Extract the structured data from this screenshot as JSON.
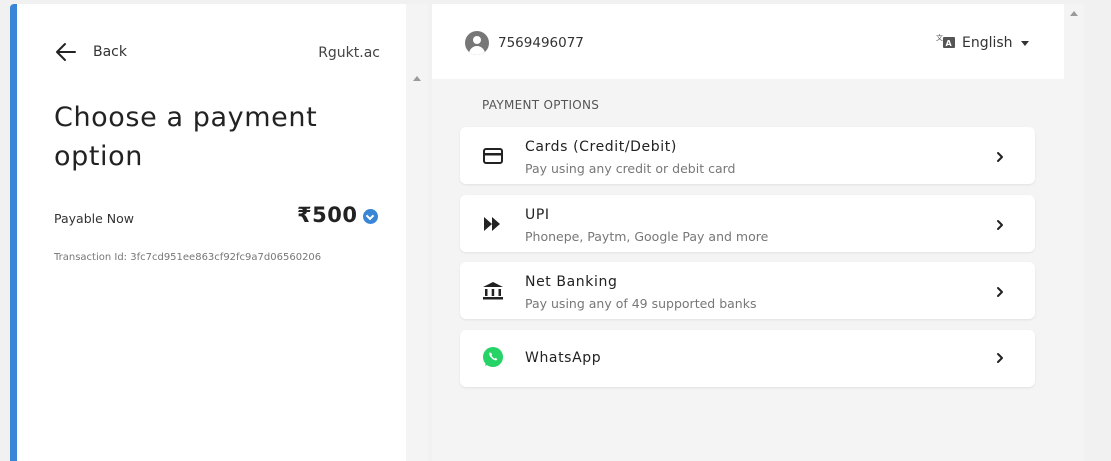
{
  "left": {
    "back_label": "Back",
    "merchant": "Rgukt.ac",
    "title": "Choose a payment option",
    "payable_label": "Payable Now",
    "amount": "₹500",
    "transaction": "Transaction Id: 3fc7cd951ee863cf92fc9a7d06560206"
  },
  "header": {
    "phone": "7569496077",
    "language": "English"
  },
  "payment": {
    "section_label": "PAYMENT OPTIONS",
    "options": [
      {
        "title": "Cards (Credit/Debit)",
        "subtitle": "Pay using any credit or debit card",
        "icon": "card-icon"
      },
      {
        "title": "UPI",
        "subtitle": "Phonepe, Paytm, Google Pay and more",
        "icon": "upi-icon"
      },
      {
        "title": "Net Banking",
        "subtitle": "Pay using any of 49 supported banks",
        "icon": "bank-icon"
      },
      {
        "title": "WhatsApp",
        "subtitle": "",
        "icon": "whatsapp-icon"
      }
    ]
  },
  "colors": {
    "accent": "#3a86d6",
    "whatsapp": "#25d366"
  }
}
